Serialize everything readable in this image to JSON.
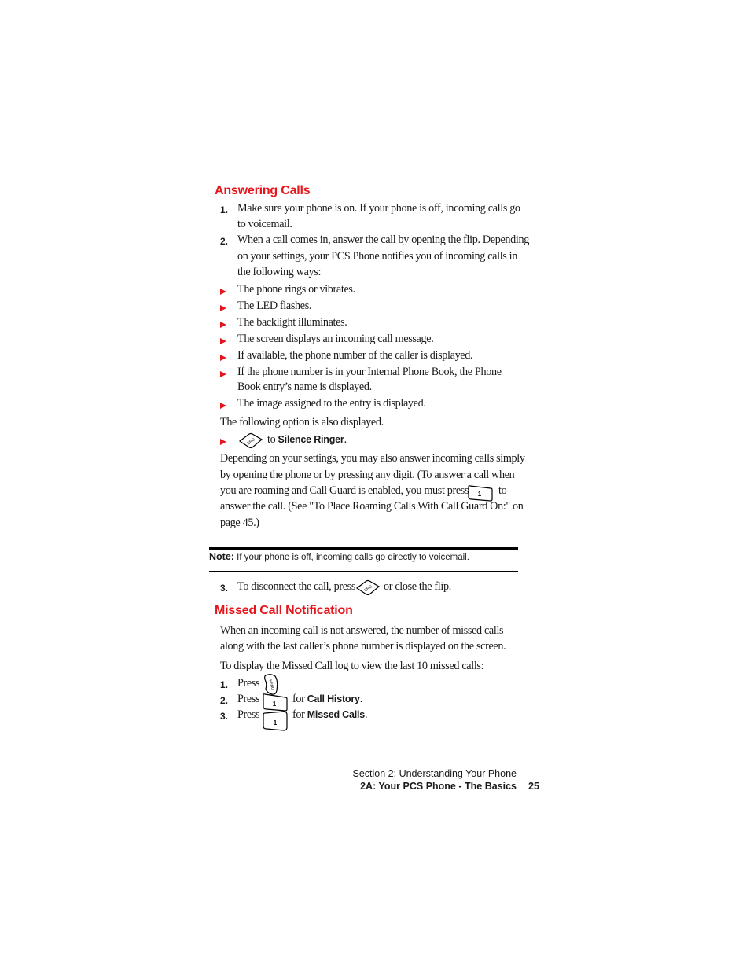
{
  "sections": {
    "answering": {
      "title": "Answering Calls",
      "step1_num": "1.",
      "step1_line1": "Make sure your phone is on. If your phone is off, incoming calls go",
      "step1_line2": "to voicemail.",
      "step2_num": "2.",
      "step2_line1": "When a call comes in, answer the call by opening the flip. Depending",
      "step2_line2": "on your settings, your PCS Phone notifies you of incoming calls in",
      "step2_line3": "the following ways:",
      "bullets": [
        "The phone rings or vibrates.",
        "The LED flashes.",
        "The backlight illuminates.",
        "The screen displays an incoming call message.",
        "If available, the phone number of the caller is displayed.",
        "If the phone number is in your Internal Phone Book, the Phone",
        "Book entry’s name is displayed.",
        "The image assigned to the entry is displayed."
      ],
      "option_intro": "The following option is also displayed.",
      "option_to": "to",
      "option_bold": "Silence Ringer",
      "option_end": ".",
      "para_line1": "Depending on your settings, you may also answer incoming calls simply",
      "para_line2": "by opening the phone or by pressing any digit. (To answer a call when",
      "para_line3a": "you are roaming and Call Guard is enabled, you must press",
      "para_line3b": "to",
      "para_line4": "answer the call. (See \"To Place Roaming Calls With Call Guard On:\" on",
      "para_line5": "page 45.)",
      "note_label": "Note:",
      "note_text": "If your phone is off, incoming calls go directly to voicemail.",
      "step3_num": "3.",
      "step3_a": "To disconnect the call, press",
      "step3_b": "or close the flip."
    },
    "missed": {
      "title": "Missed Call Notification",
      "para_line1": "When an incoming call is not answered, the number of missed calls",
      "para_line2": "along with the last caller’s phone number is displayed on the screen.",
      "intro": "To display the Missed Call log to view the last 10 missed calls:",
      "steps": [
        {
          "num": "1.",
          "press": "Press",
          "for": "",
          "bold": "",
          "end": ""
        },
        {
          "num": "2.",
          "press": "Press",
          "for": "for",
          "bold": "Call History",
          "end": "."
        },
        {
          "num": "3.",
          "press": "Press",
          "for": "for",
          "bold": "Missed Calls",
          "end": "."
        }
      ]
    }
  },
  "keys": {
    "end_key_label": "END",
    "one_key_label": "1",
    "menu_key_label": "MENU"
  },
  "footer": {
    "section": "Section 2: Understanding Your Phone",
    "chapter": "2A: Your PCS Phone - The Basics",
    "page": "25"
  },
  "colors": {
    "heading": "#e8141b",
    "bullet": "#e8141b"
  }
}
